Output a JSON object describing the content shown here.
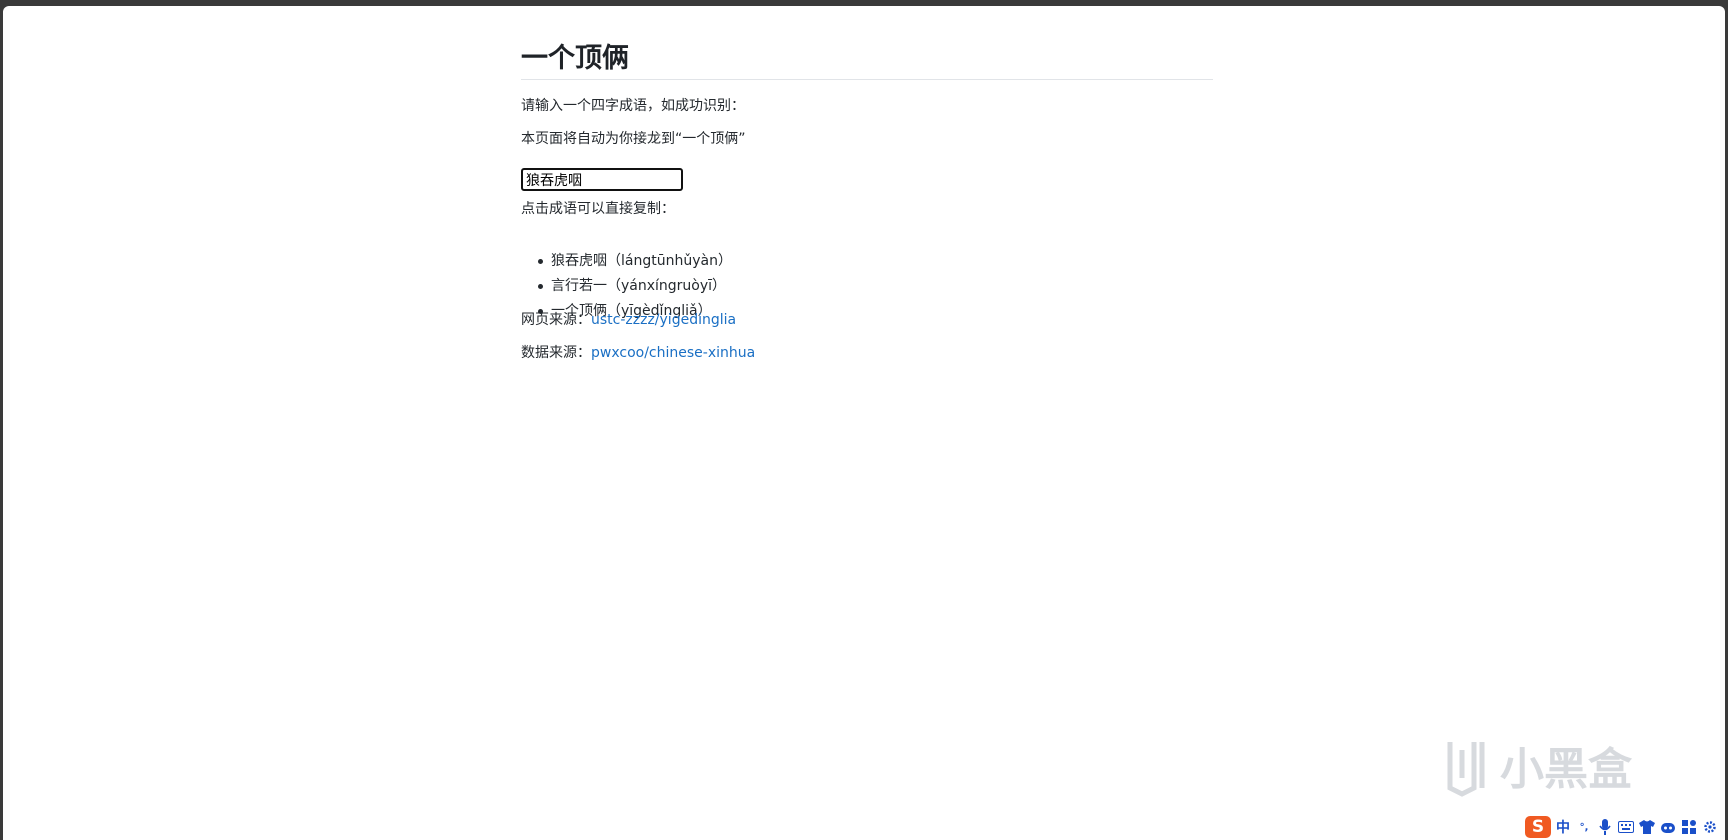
{
  "page": {
    "title": "一个顶俩",
    "intro_line1": "请输入一个四字成语，如成功识别：",
    "intro_line2": "本页面将自动为你接龙到“一个顶俩”"
  },
  "input": {
    "value": "狼吞虎咽"
  },
  "copy_hint": "点击成语可以直接复制：",
  "results": [
    {
      "text": "狼吞虎咽（lángtūnhǔyàn）"
    },
    {
      "text": "言行若一（yánxíngruòyī）"
    },
    {
      "text": "一个顶俩（yīgèdǐngliǎ）"
    }
  ],
  "sources": {
    "web_label": "网页来源：",
    "web_link": "ustc-zzzz/yigedinglia",
    "data_label": "数据来源：",
    "data_link": "pwxcoo/chinese-xinhua"
  },
  "ime": {
    "logo": "S",
    "mode": "中",
    "punct": "°,",
    "items": [
      "mic-icon",
      "keyboard-icon",
      "shirt-icon",
      "bot-icon",
      "grid-icon",
      "gear-icon"
    ]
  },
  "watermark": {
    "text": "小黑盒"
  },
  "colors": {
    "link": "#1a6fc4",
    "ime_brand": "#f05a22",
    "ime_icons": "#1a4fc9"
  }
}
